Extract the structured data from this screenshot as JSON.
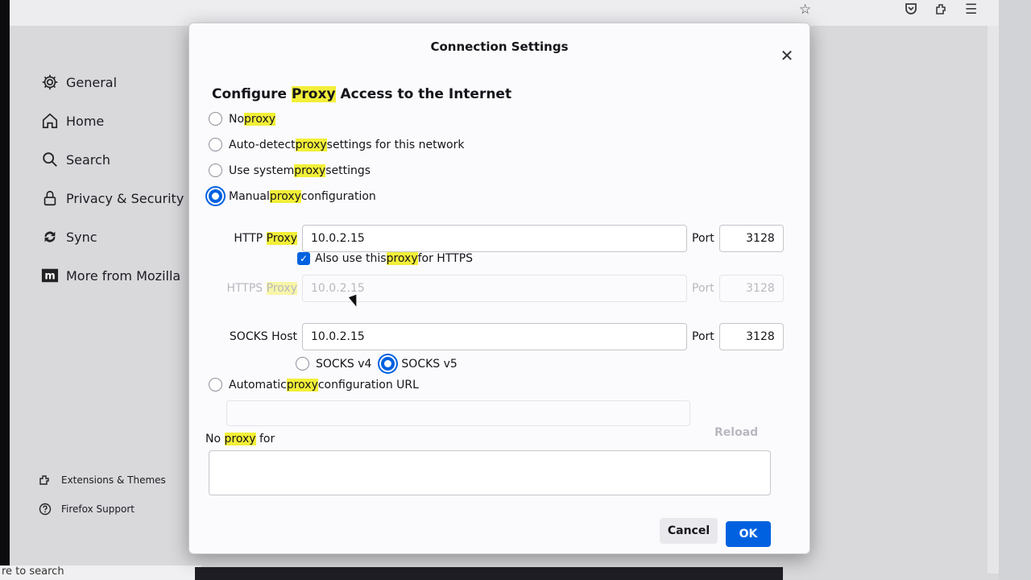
{
  "sidebar": {
    "items": [
      {
        "label": "General",
        "icon": "gear-icon"
      },
      {
        "label": "Home",
        "icon": "home-icon"
      },
      {
        "label": "Search",
        "icon": "search-icon"
      },
      {
        "label": "Privacy & Security",
        "icon": "lock-icon"
      },
      {
        "label": "Sync",
        "icon": "sync-icon"
      },
      {
        "label": "More from Mozilla",
        "icon": "mozilla-logo-icon"
      }
    ],
    "bottom": [
      {
        "label": "Extensions & Themes",
        "icon": "puzzle-icon"
      },
      {
        "label": "Firefox Support",
        "icon": "help-icon"
      }
    ]
  },
  "statusbar": {
    "text": "re to search"
  },
  "dialog": {
    "title": "Connection Settings",
    "heading": {
      "before": "Configure ",
      "highlight": "Proxy",
      "after": " Access to the Internet"
    },
    "options": [
      {
        "before": "No ",
        "highlight": "proxy",
        "after": "",
        "selected": false
      },
      {
        "before": "Auto-detect ",
        "highlight": "proxy",
        "after": " settings for this network",
        "selected": false
      },
      {
        "before": "Use system ",
        "highlight": "proxy",
        "after": " settings",
        "selected": false
      },
      {
        "before": "Manual ",
        "highlight": "proxy",
        "after": " configuration",
        "selected": true
      }
    ],
    "http": {
      "label_before": "HTTP ",
      "label_highlight": "Proxy",
      "value": "10.0.2.15",
      "port_label": "Port",
      "port": "3128"
    },
    "also_https": {
      "before": "Also use this ",
      "highlight": "proxy",
      "after": " for HTTPS",
      "checked": true
    },
    "https": {
      "label_before": "HTTPS ",
      "label_highlight": "Proxy",
      "value": "10.0.2.15",
      "port_label": "Port",
      "port": "3128"
    },
    "socks": {
      "label": "SOCKS Host",
      "value": "10.0.2.15",
      "port_label": "Port",
      "port": "3128",
      "v4": "SOCKS v4",
      "v5": "SOCKS v5",
      "selected": "v5"
    },
    "auto_url": {
      "before": "Automatic ",
      "highlight": "proxy",
      "after": " configuration URL",
      "reload": "Reload"
    },
    "no_proxy": {
      "before": "No ",
      "highlight": "proxy",
      "after": " for"
    },
    "cancel": "Cancel",
    "ok": "OK",
    "accent": "#0061e0",
    "highlight_color": "#f2ef38"
  }
}
